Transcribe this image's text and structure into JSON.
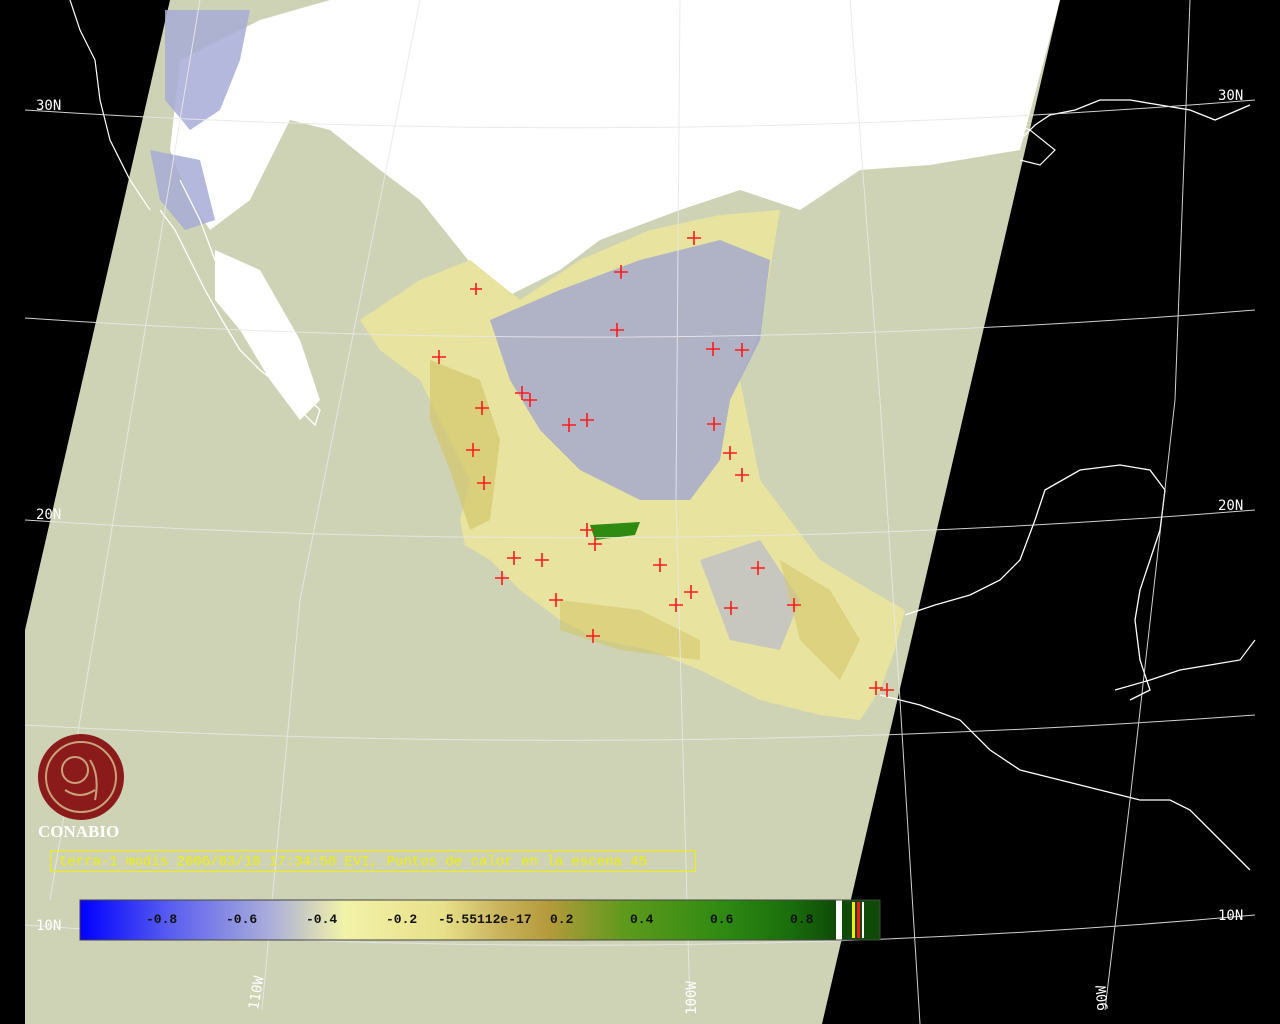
{
  "title": "terra-1 modis 2006/03/18 17:34:58 EVI, Puntos de calor en la escena 45",
  "logo": "CONABIO",
  "lat_labels": {
    "n30_left": "30N",
    "n30_right": "30N",
    "n20_left": "20N",
    "n20_right": "20N",
    "n10_left": "10N",
    "n10_right": "10N"
  },
  "lon_labels": {
    "w110": "110W",
    "w100": "100W",
    "w90": "90W"
  },
  "colorbar": {
    "ticks": [
      "-0.8",
      "-0.6",
      "-0.4",
      "-0.2",
      "-5.55112e-17",
      "0.2",
      "0.4",
      "0.6",
      "0.8"
    ]
  },
  "colors": {
    "no_data_swath": "#cdd3b4",
    "cloud": "#ffffff",
    "hotspot": "#ff1a1a",
    "graticule": "#ffffff",
    "title": "#f0f000",
    "logo": "#8b1a1a"
  }
}
